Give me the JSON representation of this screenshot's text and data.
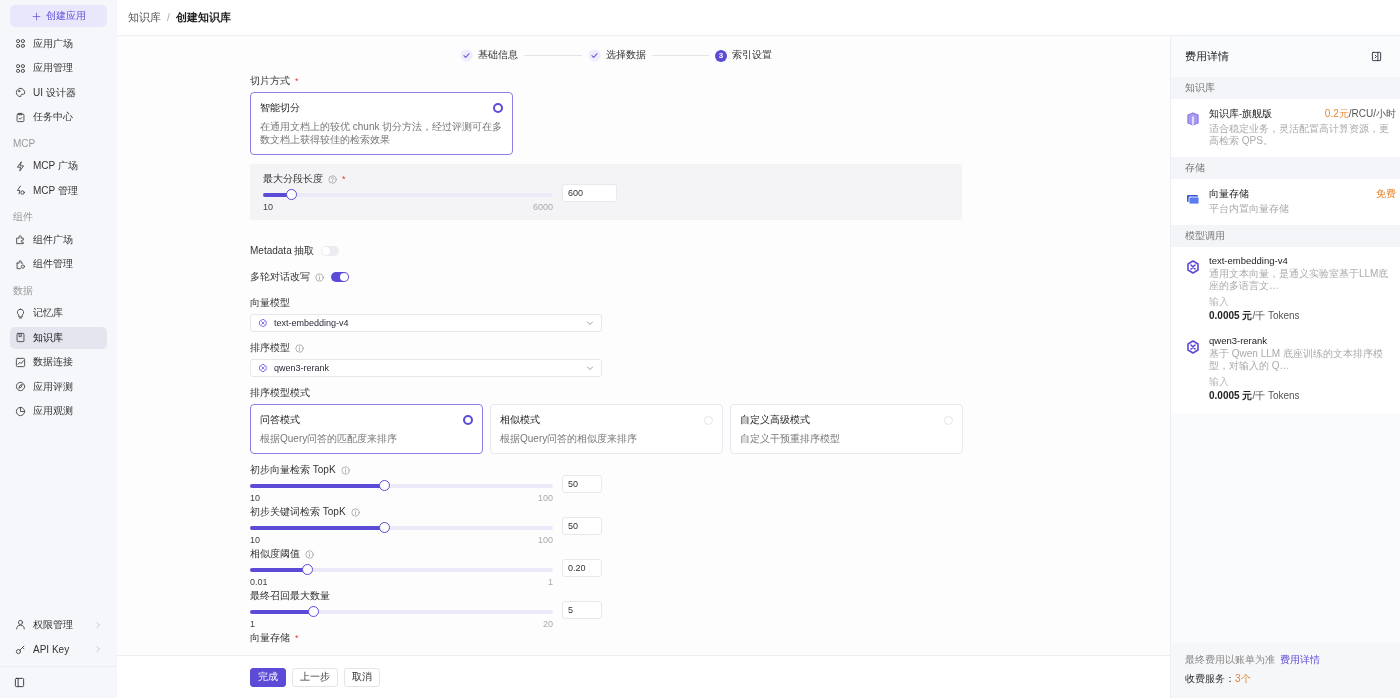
{
  "sidebar": {
    "create_button": "创建应用",
    "items": [
      {
        "kind": "item",
        "label": "应用广场",
        "selected": false
      },
      {
        "kind": "item",
        "label": "应用管理",
        "selected": false
      },
      {
        "kind": "item",
        "label": "UI 设计器",
        "selected": false
      },
      {
        "kind": "item",
        "label": "任务中心",
        "selected": false
      },
      {
        "kind": "section",
        "label": "MCP"
      },
      {
        "kind": "item",
        "label": "MCP 广场",
        "selected": false
      },
      {
        "kind": "item",
        "label": "MCP 管理",
        "selected": false
      },
      {
        "kind": "section",
        "label": "组件"
      },
      {
        "kind": "item",
        "label": "组件广场",
        "selected": false
      },
      {
        "kind": "item",
        "label": "组件管理",
        "selected": false
      },
      {
        "kind": "section",
        "label": "数据"
      },
      {
        "kind": "item",
        "label": "记忆库",
        "selected": false
      },
      {
        "kind": "item",
        "label": "知识库",
        "selected": true
      },
      {
        "kind": "item",
        "label": "数据连接",
        "selected": false
      },
      {
        "kind": "item",
        "label": "应用评测",
        "selected": false
      },
      {
        "kind": "item",
        "label": "应用观测",
        "selected": false
      }
    ],
    "bottom_items": [
      {
        "label": "权限管理"
      },
      {
        "label": "API Key"
      }
    ]
  },
  "breadcrumb": {
    "separator": "/",
    "items": [
      {
        "label": "知识库",
        "current": false
      },
      {
        "label": "创建知识库",
        "current": true
      }
    ]
  },
  "steps": [
    {
      "label": "基础信息",
      "done": true
    },
    {
      "label": "选择数据",
      "done": true
    },
    {
      "label": "索引设置",
      "done": false,
      "number": "3"
    }
  ],
  "fields": [
    {
      "kind": "radio_cards",
      "label": "切片方式",
      "required_mark": "*",
      "options": [
        {
          "title": "智能切分",
          "desc": "在通用文档上的较优 chunk 切分方法，经过评测可在多数文档上获得较佳的检索效果",
          "selected": true
        }
      ]
    },
    {
      "kind": "slider_panel",
      "label": "最大分段长度",
      "help_icon": true,
      "required_mark": "*",
      "level": 0.1,
      "min": "10",
      "max": "6000",
      "value": "600"
    },
    {
      "kind": "toggle",
      "label": "Metadata 抽取",
      "on": false
    },
    {
      "kind": "toggle",
      "label": "多轮对话改写",
      "info_icon": true,
      "on": true
    },
    {
      "kind": "select",
      "label": "向量模型",
      "value": "text-embedding-v4"
    },
    {
      "kind": "select",
      "label": "排序模型",
      "info_icon": true,
      "value": "qwen3-rerank"
    },
    {
      "kind": "radio_cards",
      "label": "排序模型模式",
      "options": [
        {
          "title": "问答模式",
          "desc": "根据Query问答的匹配度来排序",
          "selected": true
        },
        {
          "title": "相似模式",
          "desc": "根据Query问答的相似度来排序",
          "selected": false
        },
        {
          "title": "自定义高级模式",
          "desc": "自定义干预重排序模型",
          "selected": false
        }
      ]
    },
    {
      "kind": "slider",
      "label": "初步向量检索 TopK",
      "info_icon": true,
      "level": 0.445,
      "min": "10",
      "max": "100",
      "value": "50"
    },
    {
      "kind": "slider",
      "label": "初步关键词检索 TopK",
      "info_icon": true,
      "level": 0.445,
      "min": "10",
      "max": "100",
      "value": "50"
    },
    {
      "kind": "slider",
      "label": "相似度阈值",
      "info_icon": true,
      "level": 0.19,
      "min": "0.01",
      "max": "1",
      "value": "0.20"
    },
    {
      "kind": "slider",
      "label": "最终召回最大数量",
      "level": 0.21,
      "min": "1",
      "max": "20",
      "value": "5"
    },
    {
      "kind": "heading",
      "label": "向量存储",
      "required_mark": "*"
    }
  ],
  "footer_buttons": [
    {
      "label": "完成",
      "kind": "primary"
    },
    {
      "label": "上一步",
      "kind": "default"
    },
    {
      "label": "取消",
      "kind": "default"
    }
  ],
  "cost_panel": {
    "title": "费用详情",
    "sections": [
      {
        "title": "知识库",
        "items": [
          {
            "kind": "plan",
            "name": "知识库-旗舰版",
            "desc": "适合稳定业务，灵活配置高计算资源，更高检索 QPS。",
            "price": "0.2元",
            "unit": "/RCU/小时"
          }
        ]
      },
      {
        "title": "存储",
        "items": [
          {
            "kind": "storage",
            "name": "向量存储",
            "desc": "平台内置向量存储",
            "price": "免费"
          }
        ]
      },
      {
        "title": "模型调用",
        "items": [
          {
            "kind": "model",
            "name": "text-embedding-v4",
            "desc": "通用文本向量，是通义实验室基于LLM底座的多语言文…",
            "input_label": "输入",
            "price": "0.0005 元",
            "unit": "/千 Tokens"
          },
          {
            "kind": "model",
            "name": "qwen3-rerank",
            "desc": "基于 Qwen LLM 底座训练的文本排序模型，对输入的 Q…",
            "input_label": "输入",
            "price": "0.0005 元",
            "unit": "/千 Tokens"
          }
        ]
      }
    ],
    "note": "最终费用以账单为准",
    "note_link": "费用详情",
    "count_label": "收费服务：",
    "count": "3个"
  }
}
